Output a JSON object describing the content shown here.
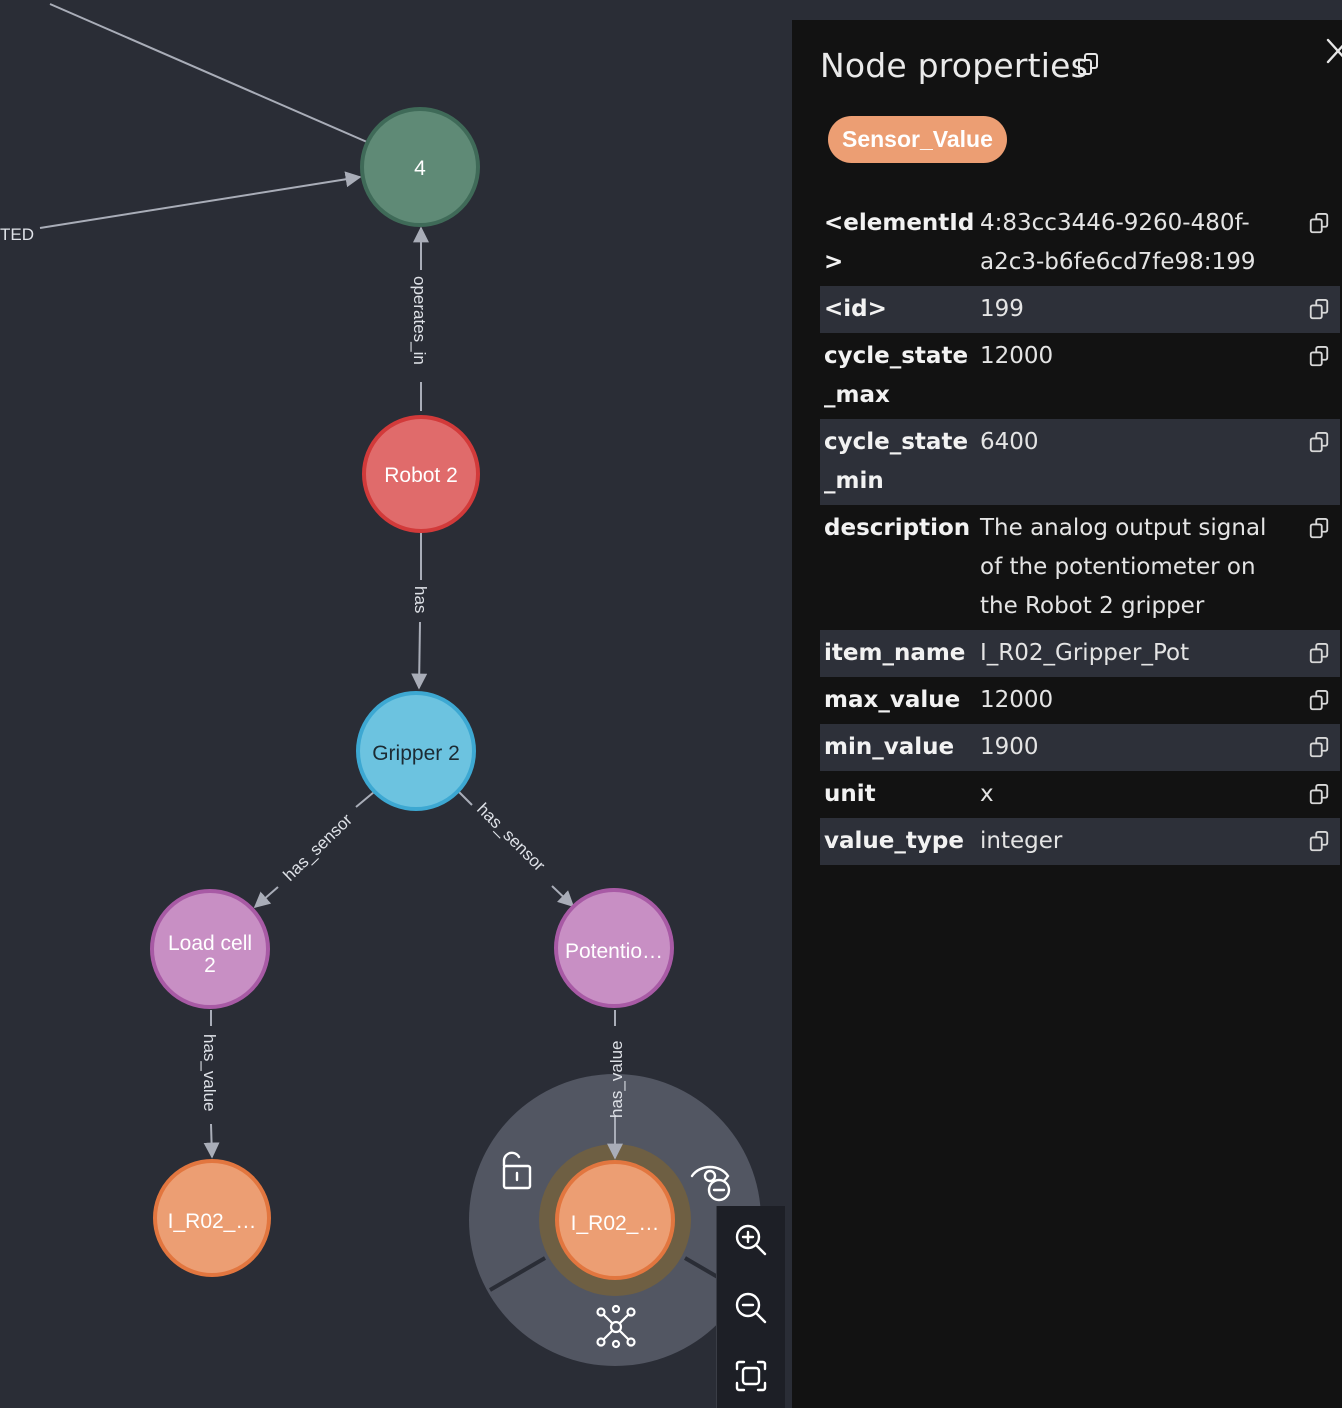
{
  "graph": {
    "nodes": [
      {
        "id": "n4",
        "label": "4",
        "color": "#5f8a76",
        "border": "#3f6a58",
        "text_color": "#ffffff"
      },
      {
        "id": "robot",
        "label": "Robot 2",
        "color": "#e06b6b",
        "border": "#d23a3a",
        "text_color": "#ffffff"
      },
      {
        "id": "gripper",
        "label": "Gripper 2",
        "color": "#6cc3e0",
        "border": "#3da8d2",
        "text_color": "#1c2b33"
      },
      {
        "id": "loadcell",
        "label_lines": [
          "Load cell",
          "2"
        ],
        "color": "#c88fc4",
        "border": "#a85aa5",
        "text_color": "#ffffff"
      },
      {
        "id": "pot",
        "label": "Potentio…",
        "color": "#c88fc4",
        "border": "#a85aa5",
        "text_color": "#ffffff"
      },
      {
        "id": "val1",
        "label": "I_R02_…",
        "color": "#ec9e73",
        "border": "#e2763f",
        "text_color": "#ffffff"
      },
      {
        "id": "val2",
        "label": "I_R02_…",
        "color": "#ec9e73",
        "border": "#e2763f",
        "text_color": "#ffffff"
      }
    ],
    "edges": [
      {
        "id": "e-op",
        "label": "operates_in"
      },
      {
        "id": "e-has",
        "label": "has"
      },
      {
        "id": "e-hs1",
        "label": "has_sensor"
      },
      {
        "id": "e-hs2",
        "label": "has_sensor"
      },
      {
        "id": "e-hv1",
        "label": "has_value"
      },
      {
        "id": "e-hv2",
        "label": "has_value"
      },
      {
        "id": "e-ted",
        "label": "TED"
      }
    ],
    "context_menu": {
      "items": [
        {
          "name": "unlock-icon",
          "action": "unpin"
        },
        {
          "name": "hide-node-icon",
          "action": "hide"
        },
        {
          "name": "expand-icon",
          "action": "expand"
        }
      ]
    }
  },
  "zoom_toolbar": {
    "buttons": [
      {
        "name": "zoom-in-icon"
      },
      {
        "name": "zoom-out-icon"
      },
      {
        "name": "fit-to-screen-icon"
      }
    ]
  },
  "panel": {
    "title": "Node properties",
    "label_chip": "Sensor_Value",
    "label_chip_color": "#ec9e73",
    "properties": [
      {
        "key": "<elementId>",
        "value": "4:83cc3446-9260-480f-a2c3-b6fe6cd7fe98:199"
      },
      {
        "key": "<id>",
        "value": "199"
      },
      {
        "key": "cycle_state_max",
        "value": "12000"
      },
      {
        "key": "cycle_state_min",
        "value": "6400"
      },
      {
        "key": "description",
        "value": "The analog output signal of the potentiometer on the Robot 2 gripper"
      },
      {
        "key": "item_name",
        "value": "I_R02_Gripper_Pot"
      },
      {
        "key": "max_value",
        "value": "12000"
      },
      {
        "key": "min_value",
        "value": "1900"
      },
      {
        "key": "unit",
        "value": "x"
      },
      {
        "key": "value_type",
        "value": "integer"
      }
    ]
  }
}
